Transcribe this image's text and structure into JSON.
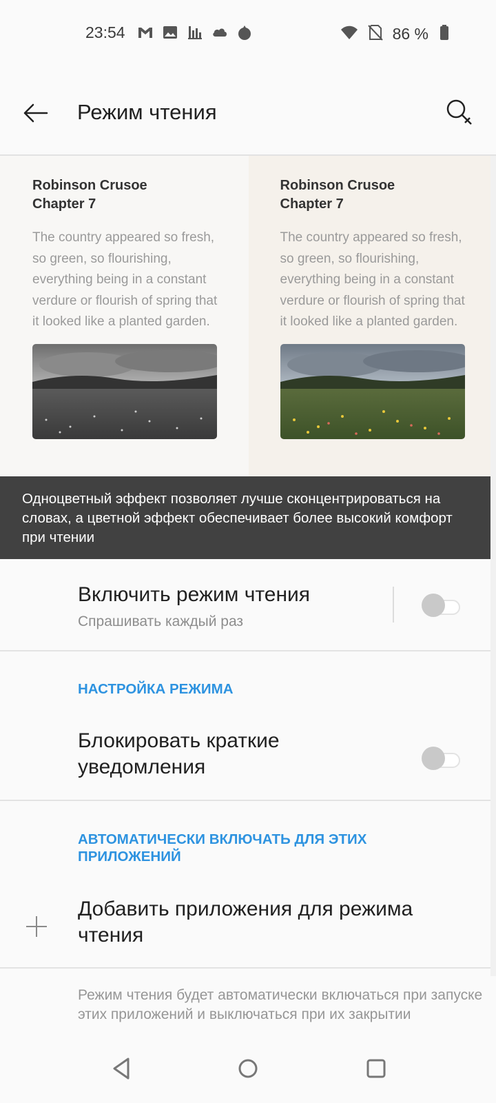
{
  "status_bar": {
    "time": "23:54",
    "battery": "86 %",
    "left_icons": [
      "gmail-icon",
      "gallery-icon",
      "chart-icon",
      "cloud-icon",
      "flame-icon"
    ],
    "right_icons": [
      "wifi-icon",
      "no-sim-icon",
      "battery-icon"
    ]
  },
  "app_bar": {
    "title": "Режим чтения",
    "back_icon": "arrow-back-icon",
    "search_icon": "search-icon"
  },
  "preview": {
    "mono": {
      "heading_line1": "Robinson Crusoe",
      "heading_line2": "Chapter 7",
      "body": "The country appeared so fresh, so green, so flourishing, everything being in a constant verdure or flourish of spring that it looked like a planted garden."
    },
    "color": {
      "heading_line1": "Robinson Crusoe",
      "heading_line2": "Chapter 7",
      "body": "The country appeared so fresh, so green, so flourishing, everything being in a constant verdure or flourish of spring that it looked like a planted garden."
    }
  },
  "info_banner": {
    "text": "Одноцветный эффект позволяет лучше сконцентрироваться на словах, а цветной эффект обеспечивает более высокий комфорт при чтении"
  },
  "settings": {
    "enable": {
      "title": "Включить режим чтения",
      "subtitle": "Спрашивать каждый раз",
      "toggle_on": false
    },
    "mode_section": {
      "header": "НАСТРОЙКА РЕЖИМА"
    },
    "block_notifications": {
      "title_line1": "Блокировать краткие",
      "title_line2": "уведомления",
      "toggle_on": false
    },
    "auto_section": {
      "header_line1": "АВТОМАТИЧЕСКИ ВКЛЮЧАТЬ ДЛЯ ЭТИХ",
      "header_line2": "ПРИЛОЖЕНИЙ"
    },
    "add_apps": {
      "title_line1": "Добавить приложения для режима",
      "title_line2": "чтения"
    },
    "footer_note": "Режим чтения будет автоматически включаться при запуске этих приложений и выключаться при их закрытии"
  },
  "colors": {
    "accent": "#2e93e0",
    "banner_bg": "#414141",
    "background": "#fafafa"
  },
  "nav_bar": {
    "icons": [
      "nav-back-icon",
      "nav-home-icon",
      "nav-recents-icon"
    ]
  }
}
